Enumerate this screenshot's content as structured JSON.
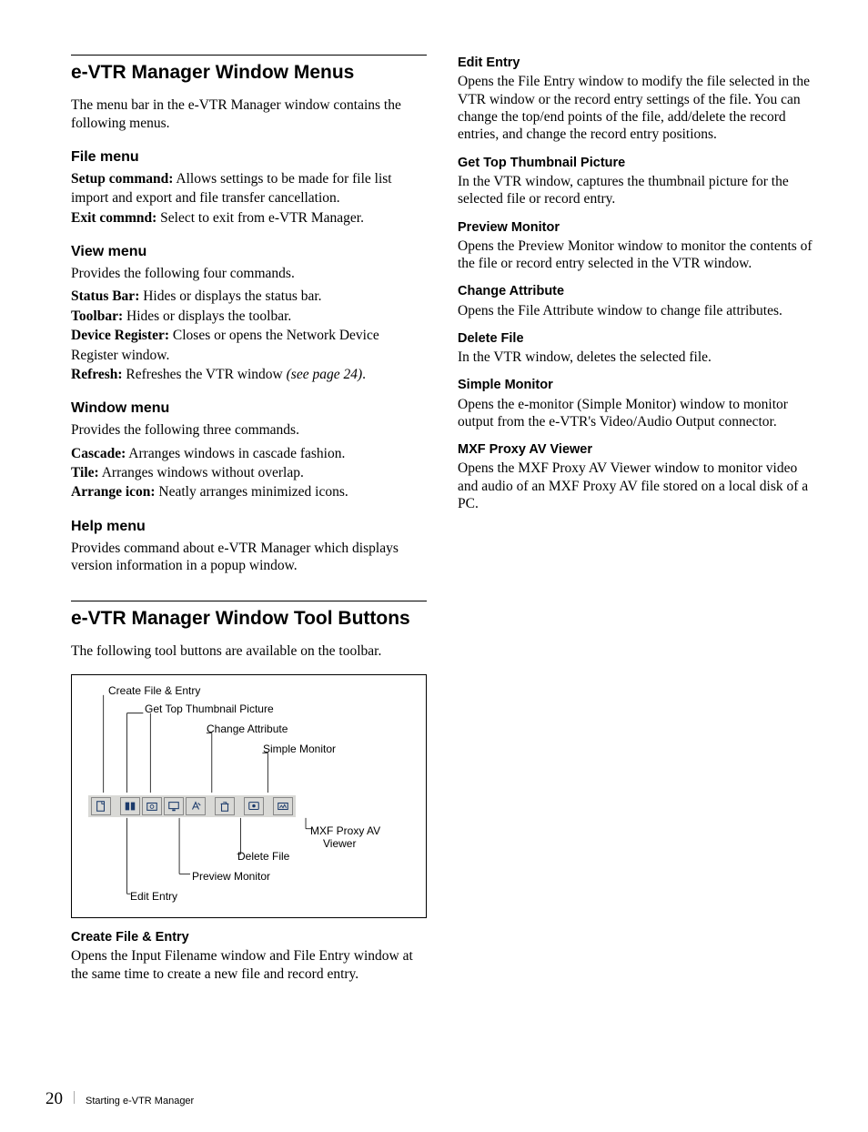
{
  "leftCol": {
    "section1": {
      "title": "e-VTR Manager Window Menus",
      "intro": "The menu bar in the e-VTR Manager window contains the following menus.",
      "fileMenu": {
        "heading": "File menu",
        "setup_term": "Setup command:",
        "setup_text": " Allows settings to be made for file list",
        "setup_text2": "import and export and file transfer cancellation.",
        "exit_term": "Exit commnd:",
        "exit_text": " Select to exit from e-VTR Manager."
      },
      "viewMenu": {
        "heading": "View menu",
        "intro": "Provides the following four commands.",
        "status_term": "Status Bar:",
        "status_text": " Hides or displays the status bar.",
        "toolbar_term": "Toolbar:",
        "toolbar_text": " Hides or displays the toolbar.",
        "device_term": "Device Register:",
        "device_text": " Closes or opens the Network Device",
        "device_text2": "Register window.",
        "refresh_term": "Refresh:",
        "refresh_text": " Refreshes the VTR window ",
        "refresh_ref": "(see page 24)",
        "refresh_dot": "."
      },
      "windowMenu": {
        "heading": "Window menu",
        "intro": "Provides the following three commands.",
        "cascade_term": "Cascade:",
        "cascade_text": " Arranges windows in cascade fashion.",
        "tile_term": "Tile:",
        "tile_text": " Arranges windows without overlap.",
        "arrange_term": "Arrange icon:",
        "arrange_text": " Neatly arranges minimized icons."
      },
      "helpMenu": {
        "heading": "Help menu",
        "text": "Provides command about e-VTR Manager which displays version information in a popup window."
      }
    },
    "section2": {
      "title": "e-VTR Manager Window Tool Buttons",
      "intro": "The following tool buttons are available on the toolbar.",
      "fig": {
        "labels": {
          "create": "Create File & Entry",
          "getTop": "Get Top Thumbnail Picture",
          "changeAttr": "Change Attribute",
          "simpleMon": "Simple Monitor",
          "mxf": "MXF Proxy AV",
          "mxf2": "Viewer",
          "deleteFile": "Delete File",
          "previewMon": "Preview Monitor",
          "editEntry": "Edit Entry"
        }
      },
      "createEntry": {
        "heading": "Create File & Entry",
        "text": "Opens the Input Filename window and File Entry window at the same time to create a new file and record entry."
      }
    }
  },
  "rightCol": {
    "editEntry": {
      "heading": "Edit Entry",
      "text": "Opens the File Entry window to modify the file selected in the VTR window or the record entry settings of the file. You can change the top/end points of the file, add/delete the record entries, and change the record entry positions."
    },
    "getTop": {
      "heading": "Get Top Thumbnail Picture",
      "text": "In the VTR window, captures the thumbnail picture for the selected file or record entry."
    },
    "previewMon": {
      "heading": "Preview Monitor",
      "text": "Opens the Preview Monitor window to monitor the contents of the file or record entry selected in the VTR window."
    },
    "changeAttr": {
      "heading": "Change Attribute",
      "text": "Opens the File Attribute window to change file attributes."
    },
    "deleteFile": {
      "heading": "Delete File",
      "text": "In the VTR window, deletes the selected file."
    },
    "simpleMon": {
      "heading": "Simple Monitor",
      "text": "Opens the e-monitor (Simple Monitor) window to monitor output from the e-VTR's Video/Audio Output connector."
    },
    "mxf": {
      "heading": "MXF Proxy AV Viewer",
      "text": "Opens the MXF Proxy AV Viewer window to monitor video and audio of an MXF Proxy AV file stored on a local disk of a PC."
    }
  },
  "footer": {
    "page": "20",
    "chapter": "Starting e-VTR Manager"
  }
}
